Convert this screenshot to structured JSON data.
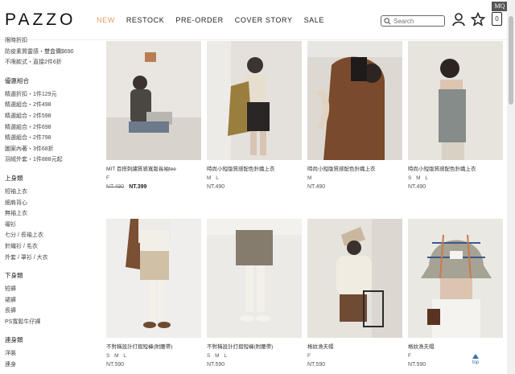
{
  "header": {
    "logo": "PAZZO",
    "nav": [
      "NEW",
      "RESTOCK",
      "PRE-ORDER",
      "COVER STORY",
      "SALE"
    ],
    "search_placeholder": "Search",
    "cart_count": "0",
    "mq": "MQ"
  },
  "sidebar": {
    "top_items": [
      "限時折扣",
      "防疫素質靈感・雙盒價$690",
      "不限款式・直接2件6折"
    ],
    "groups": [
      {
        "title": "優惠組合",
        "items": [
          "精選折扣・1件129元",
          "精選組合・2件498",
          "精選組合・2件598",
          "精選組合・2件698",
          "精選組合・2件798",
          "圖案內著・3件68折",
          "羽絨外套・1件888元起"
        ]
      },
      {
        "title": "上身類",
        "items": [
          "短袖上衣",
          "細肩背心",
          "無袖上衣",
          "襯衫",
          "七分 / 長袖上衣",
          "針織衫 / 毛衣",
          "外套 / 罩衫 / 大衣"
        ]
      },
      {
        "title": "下身類",
        "items": [
          "短褲",
          "裙褲",
          "長褲",
          "PS寬鬆牛仔褲"
        ]
      },
      {
        "title": "連身類",
        "items": [
          "洋裝",
          "連身"
        ]
      }
    ]
  },
  "products": [
    {
      "name": "MIT 百搭刺繡質感寬版長袖tee",
      "sizes": "F",
      "old_price": "NT.490",
      "price": "NT.399"
    },
    {
      "name": "時尚小短版質感配色針織上衣",
      "sizes": "M L",
      "old_price": "",
      "price": "NT.490"
    },
    {
      "name": "時尚小短版質感配色針織上衣",
      "sizes": "M",
      "old_price": "",
      "price": "NT.490"
    },
    {
      "name": "時尚小短版質感配色針織上衣",
      "sizes": "S M L",
      "old_price": "",
      "price": "NT.490"
    },
    {
      "name": "不對稱設計打摺短褲(附腰帶)",
      "sizes": "S M L",
      "old_price": "",
      "price": "NT.590"
    },
    {
      "name": "不對稱設計打摺短褲(附腰帶)",
      "sizes": "S M L",
      "old_price": "",
      "price": "NT.590"
    },
    {
      "name": "格紋漁夫帽",
      "sizes": "F",
      "old_price": "",
      "price": "NT.590"
    },
    {
      "name": "格紋漁夫帽",
      "sizes": "F",
      "old_price": "",
      "price": "NT.590"
    }
  ],
  "top_label": "top",
  "colors": {
    "accent": "#e59b6a",
    "text": "#333333"
  }
}
